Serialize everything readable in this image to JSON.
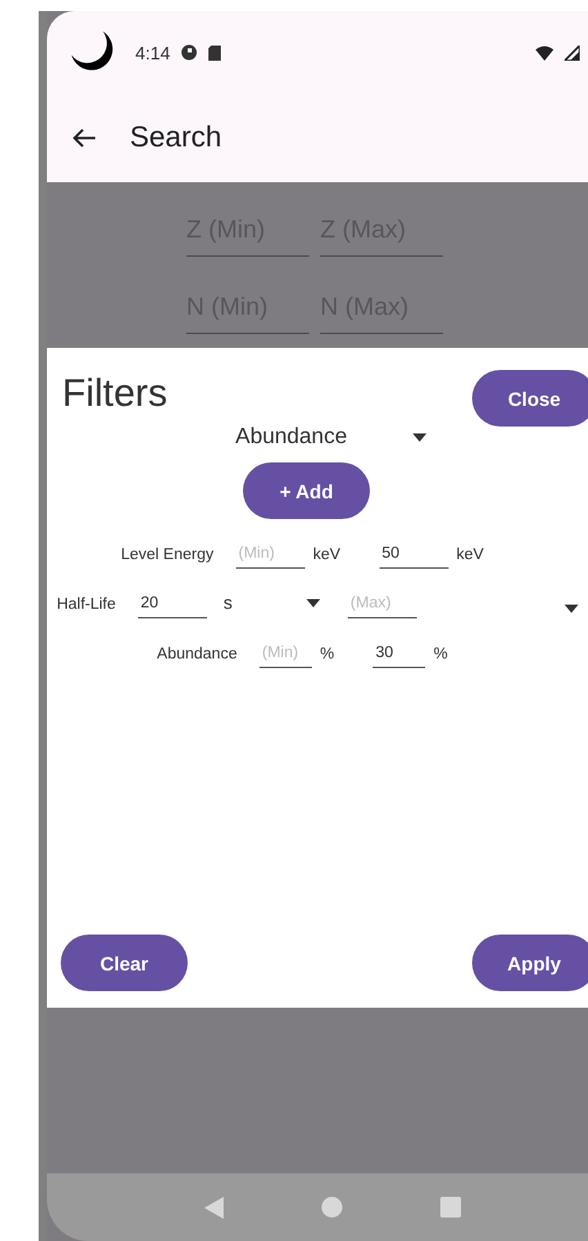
{
  "status_bar": {
    "time": "4:14"
  },
  "app_bar": {
    "title": "Search"
  },
  "background_fields": [
    {
      "placeholder": "Z (Min)"
    },
    {
      "placeholder": "Z (Max)"
    },
    {
      "placeholder": "N (Min)"
    },
    {
      "placeholder": "N (Max)"
    }
  ],
  "dialog": {
    "title": "Filters",
    "close_button": "Close",
    "filter_type": {
      "value": "Abundance"
    },
    "add_button": "+ Add",
    "rows": [
      {
        "label": "Level Energy",
        "fields": [
          {
            "placeholder": "(Min)",
            "unit": "keV",
            "kind": "text"
          },
          {
            "value": "50",
            "unit": "keV",
            "kind": "text"
          }
        ]
      },
      {
        "label": "Half-Life",
        "fields": [
          {
            "value": "20",
            "unit": "s",
            "kind": "dropdown"
          },
          {
            "placeholder": "(Max)",
            "kind": "dropdown"
          }
        ]
      },
      {
        "label": "Abundance",
        "fields": [
          {
            "placeholder": "(Min)",
            "unit": "%",
            "kind": "text"
          },
          {
            "value": "30",
            "unit": "%",
            "kind": "text"
          }
        ]
      }
    ],
    "clear_button": "Clear",
    "apply_button": "Apply"
  }
}
